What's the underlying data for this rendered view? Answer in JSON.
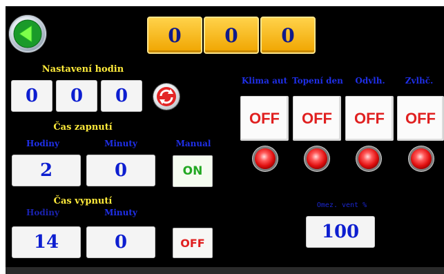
{
  "top_counters": [
    "0",
    "0",
    "0"
  ],
  "clock_setting": {
    "title": "Nastavení hodin",
    "values": [
      "0",
      "0",
      "0"
    ]
  },
  "on_time": {
    "title": "Čas zapnutí",
    "hours_label": "Hodiny",
    "minutes_label": "Minuty",
    "hours": "2",
    "minutes": "0"
  },
  "manual": {
    "label": "Manual",
    "button": "ON"
  },
  "off_time": {
    "title": "Čas vypnutí",
    "hours_label": "Hodiny",
    "minutes_label": "Minuty",
    "hours": "14",
    "minutes": "0",
    "button": "OFF"
  },
  "channels": [
    {
      "label": "Klima aut",
      "state": "OFF"
    },
    {
      "label": "Topení den",
      "state": "OFF"
    },
    {
      "label": "Odvlh.",
      "state": "OFF"
    },
    {
      "label": "Zvlhč.",
      "state": "OFF"
    }
  ],
  "fan_limit": {
    "label": "Omez. vent %",
    "value": "100"
  },
  "colors": {
    "background": "#000000",
    "yellow_label": "#ffeb3b",
    "blue_text": "#1f2fe8",
    "off_red": "#e02020",
    "on_green": "#22a822",
    "counter_orange": "#f0a500"
  },
  "icons": {
    "back": "back-arrow-icon",
    "refresh": "refresh-icon",
    "indicator": "indicator-lamp-icon"
  }
}
